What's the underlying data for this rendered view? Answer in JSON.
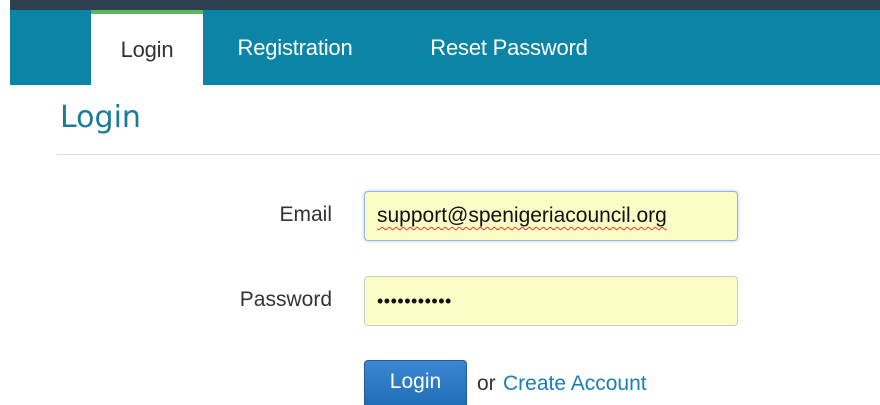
{
  "nav": {
    "tabs": [
      {
        "label": "Login",
        "active": true
      },
      {
        "label": "Registration",
        "active": false
      },
      {
        "label": "Reset Password",
        "active": false
      }
    ]
  },
  "main": {
    "title": "Login",
    "form": {
      "email_label": "Email",
      "email_value": "support@spenigeriacouncil.org",
      "password_label": "Password",
      "password_value": "•••••••••••",
      "submit_label": "Login",
      "or_text": "or",
      "create_account_label": "Create Account"
    }
  },
  "colors": {
    "nav_background": "#0b84a5",
    "active_tab_accent": "#5cb85c",
    "autofill_background": "#fbfdc5",
    "button_primary": "#1e6cb4",
    "link": "#1a7fb5",
    "title": "#1a7a99"
  }
}
